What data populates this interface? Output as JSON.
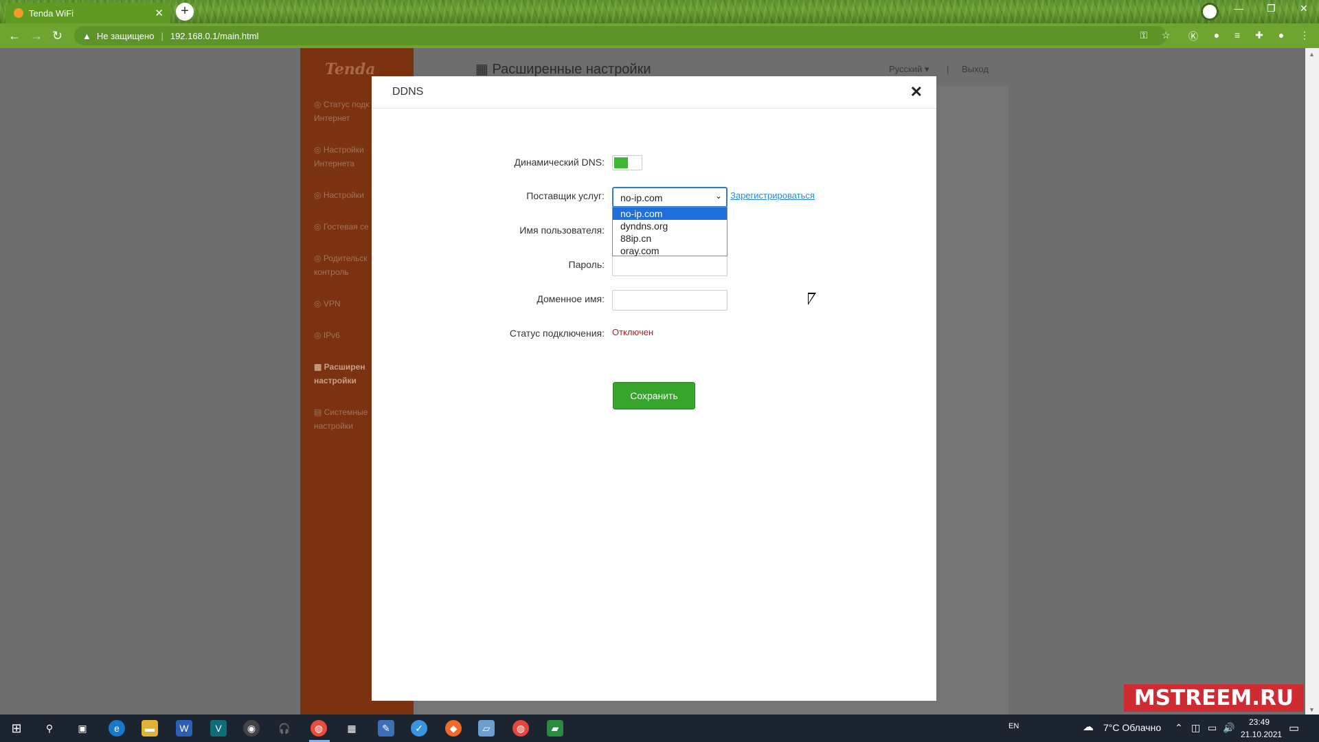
{
  "browser": {
    "tab_title": "Tenda WiFi",
    "tab_close": "✕",
    "new_tab": "+",
    "security_text": "Не защищено",
    "url": "192.168.0.1/main.html",
    "win_minimize": "—",
    "win_restore": "❐",
    "win_close": "✕"
  },
  "app": {
    "logo": "Tenda",
    "page_title": "Расширенные настройки",
    "language": "Русский ▾",
    "separator": "|",
    "logout": "Выход",
    "sidebar": [
      {
        "label": "Статус подк Интернет",
        "active": false
      },
      {
        "label": "Настройки Интернета",
        "active": false
      },
      {
        "label": "Настройки",
        "active": false
      },
      {
        "label": "Гостевая се",
        "active": false
      },
      {
        "label": "Родительск контроль",
        "active": false
      },
      {
        "label": "VPN",
        "active": false
      },
      {
        "label": "IPv6",
        "active": false
      },
      {
        "label": "Расширен настройки",
        "active": true
      },
      {
        "label": "Системные настройки",
        "active": false
      }
    ]
  },
  "modal": {
    "title": "DDNS",
    "close": "✕",
    "labels": {
      "ddns": "Динамический DNS:",
      "provider": "Поставщик услуг:",
      "username": "Имя пользователя:",
      "password": "Пароль:",
      "domain": "Доменное имя:",
      "status": "Статус подключения:"
    },
    "ddns_enabled": true,
    "provider_selected": "no-ip.com",
    "provider_options": [
      "no-ip.com",
      "dyndns.org",
      "88ip.cn",
      "oray.com"
    ],
    "register_link": "Зарегистрироваться",
    "status_value": "Отключен",
    "save_button": "Сохранить"
  },
  "watermark": "MSTREEM.RU",
  "taskbar": {
    "lang": "EN",
    "weather": "7°C  Облачно",
    "time": "23:49",
    "date": "21.10.2021"
  }
}
